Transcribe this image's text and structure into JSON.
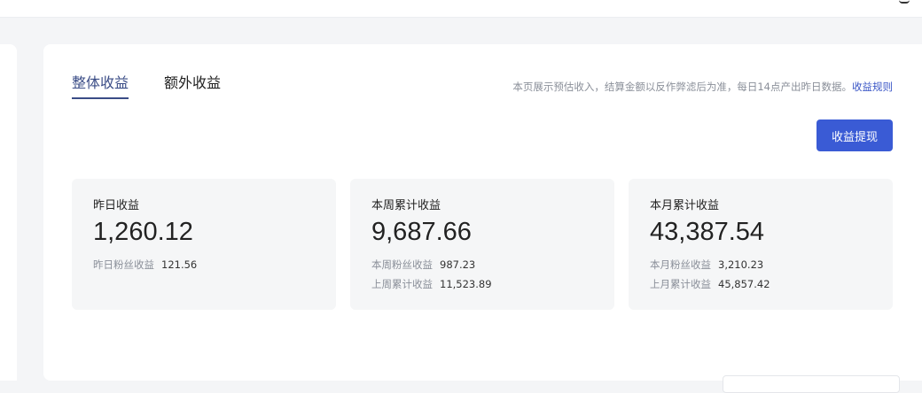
{
  "tabs": [
    {
      "label": "整体收益",
      "active": true
    },
    {
      "label": "额外收益",
      "active": false
    }
  ],
  "notice": {
    "text": "本页展示预估收入，结算金额以反作弊滤后为准，每日14点产出昨日数据。",
    "link": "收益规则"
  },
  "withdraw_button": "收益提现",
  "cards": [
    {
      "title": "昨日收益",
      "value": "1,260.12",
      "rows": [
        {
          "label": "昨日粉丝收益",
          "value": "121.56"
        }
      ]
    },
    {
      "title": "本周累计收益",
      "value": "9,687.66",
      "rows": [
        {
          "label": "本周粉丝收益",
          "value": "987.23"
        },
        {
          "label": "上周累计收益",
          "value": "11,523.89"
        }
      ]
    },
    {
      "title": "本月累计收益",
      "value": "43,387.54",
      "rows": [
        {
          "label": "本月粉丝收益",
          "value": "3,210.23"
        },
        {
          "label": "上月累计收益",
          "value": "45,857.42"
        }
      ]
    }
  ],
  "colors": {
    "accent": "#3a5bd5",
    "tab_active": "#3a4c86",
    "card_bg": "#f5f6f7",
    "page_bg": "#f4f5f7"
  }
}
